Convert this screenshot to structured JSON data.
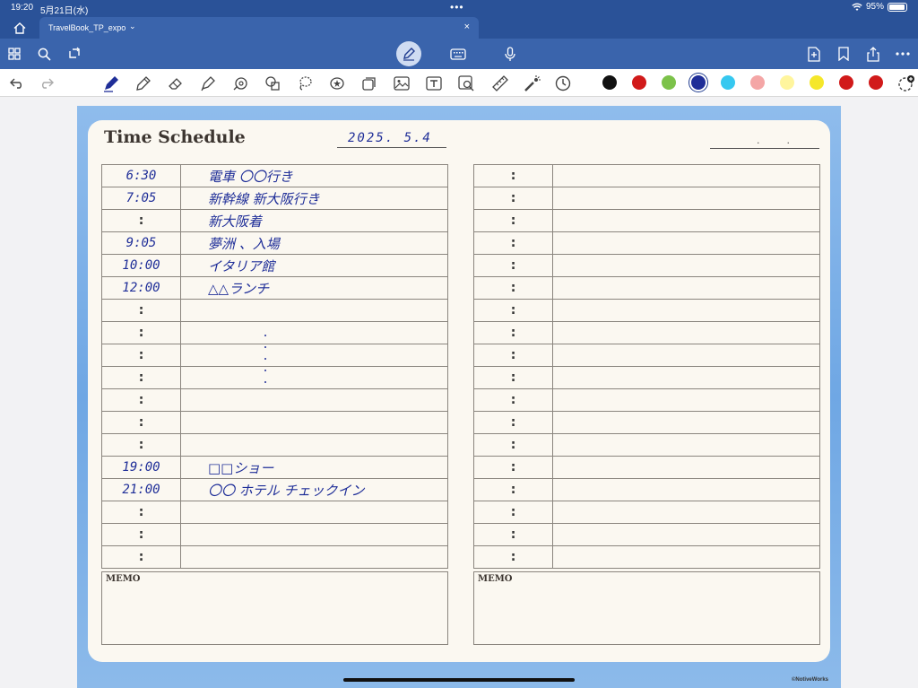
{
  "status_bar": {
    "time": "19:20",
    "date": "5月21日(水)",
    "battery": "95%",
    "battery_level": 0.95,
    "icons": [
      "multitask-dots-icon",
      "wifi-icon",
      "battery-icon"
    ]
  },
  "tab": {
    "title": "TravelBook_TP_expo",
    "chevron": "⌄",
    "close": "×"
  },
  "app_bar": {
    "icons": [
      "grid-icon",
      "search-icon",
      "lasso-rotate-icon",
      "pen-mode-icon",
      "keyboard-icon",
      "microphone-icon",
      "add-page-icon",
      "bookmark-icon",
      "share-icon",
      "more-icon"
    ]
  },
  "tools": {
    "icons": [
      "undo-icon",
      "redo-icon",
      "fountain-pen-icon",
      "pencil-icon",
      "eraser-icon",
      "highlighter-icon",
      "shape-icon",
      "shapes-fill-icon",
      "lasso-icon",
      "sticker-icon",
      "layer-icon",
      "image-icon",
      "text-box-icon",
      "screenshot-icon",
      "ruler-icon",
      "laser-pointer-icon",
      "clock-icon",
      "color-add-icon"
    ],
    "colors": [
      "#111111",
      "#d11a1a",
      "#7cc24a",
      "#1f2e98",
      "#36c8f0",
      "#f4a6a6",
      "#fff59d",
      "#f5e72a",
      "#d11a1a",
      "#d11a1a"
    ],
    "selected_color_index": 3
  },
  "notebook": {
    "title": "Time Schedule",
    "date": "2025. 5.4",
    "date_right_dots": "..",
    "left_rows": [
      {
        "time": "6:30",
        "event": "電車 〇〇行き"
      },
      {
        "time": "7:05",
        "event": "新幹線 新大阪行き"
      },
      {
        "time": ":",
        "event": "新大阪着"
      },
      {
        "time": "9:05",
        "event": "夢洲 、入場"
      },
      {
        "time": "10:00",
        "event": "イタリア館"
      },
      {
        "time": "12:00",
        "event": "△△ランチ"
      },
      {
        "time": ":",
        "event": ""
      },
      {
        "time": ":",
        "event": ""
      },
      {
        "time": ":",
        "event": ""
      },
      {
        "time": ":",
        "event": ""
      },
      {
        "time": ":",
        "event": ""
      },
      {
        "time": ":",
        "event": ""
      },
      {
        "time": ":",
        "event": ""
      },
      {
        "time": "19:00",
        "event": "□□ショー"
      },
      {
        "time": "21:00",
        "event": "〇〇 ホテル チェックイン"
      },
      {
        "time": ":",
        "event": ""
      },
      {
        "time": ":",
        "event": ""
      },
      {
        "time": ":",
        "event": ""
      }
    ],
    "right_rows": [
      {
        "time": ":",
        "event": ""
      },
      {
        "time": ":",
        "event": ""
      },
      {
        "time": ":",
        "event": ""
      },
      {
        "time": ":",
        "event": ""
      },
      {
        "time": ":",
        "event": ""
      },
      {
        "time": ":",
        "event": ""
      },
      {
        "time": ":",
        "event": ""
      },
      {
        "time": ":",
        "event": ""
      },
      {
        "time": ":",
        "event": ""
      },
      {
        "time": ":",
        "event": ""
      },
      {
        "time": ":",
        "event": ""
      },
      {
        "time": ":",
        "event": ""
      },
      {
        "time": ":",
        "event": ""
      },
      {
        "time": ":",
        "event": ""
      },
      {
        "time": ":",
        "event": ""
      },
      {
        "time": ":",
        "event": ""
      },
      {
        "time": ":",
        "event": ""
      },
      {
        "time": ":",
        "event": ""
      }
    ],
    "memo_label": "MEMO",
    "footer": "©NotiveWorks"
  }
}
